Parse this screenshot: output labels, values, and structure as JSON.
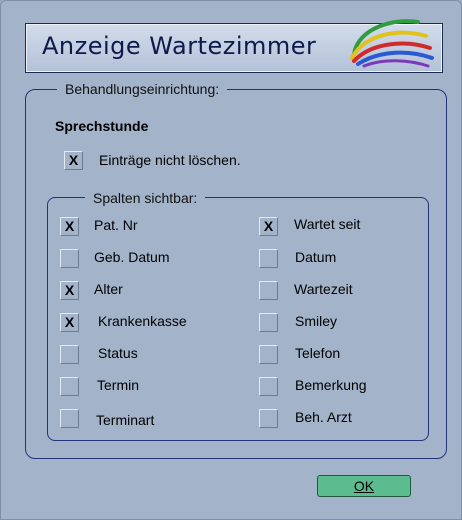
{
  "window": {
    "title": "Anzeige Wartezimmer"
  },
  "group": {
    "label": "Behandlungseinrichtung:"
  },
  "section": {
    "title": "Sprechstunde"
  },
  "keep_entries": {
    "label": "Einträge nicht löschen.",
    "checked": true,
    "mark": "X"
  },
  "columns_group": {
    "label": "Spalten sichtbar:"
  },
  "columns": [
    {
      "label": "Pat. Nr",
      "checked": true,
      "mark": "X"
    },
    {
      "label": "Geb. Datum",
      "checked": false,
      "mark": ""
    },
    {
      "label": "Alter",
      "checked": true,
      "mark": "X"
    },
    {
      "label": "Krankenkasse",
      "checked": true,
      "mark": "X"
    },
    {
      "label": "Status",
      "checked": false,
      "mark": ""
    },
    {
      "label": "Termin",
      "checked": false,
      "mark": ""
    },
    {
      "label": "Terminart",
      "checked": false,
      "mark": ""
    },
    {
      "label": "Wartet seit",
      "checked": true,
      "mark": "X"
    },
    {
      "label": "Datum",
      "checked": false,
      "mark": ""
    },
    {
      "label": "Wartezeit",
      "checked": false,
      "mark": ""
    },
    {
      "label": "Smiley",
      "checked": false,
      "mark": ""
    },
    {
      "label": "Telefon",
      "checked": false,
      "mark": ""
    },
    {
      "label": "Bemerkung",
      "checked": false,
      "mark": ""
    },
    {
      "label": "Beh. Arzt",
      "checked": false,
      "mark": ""
    }
  ],
  "ok_button": {
    "label": "OK"
  },
  "colors": {
    "background": "#a3b3ca",
    "border": "#22357a",
    "ok_button": "#5cbb8f",
    "title_text": "#0e1b4a"
  }
}
